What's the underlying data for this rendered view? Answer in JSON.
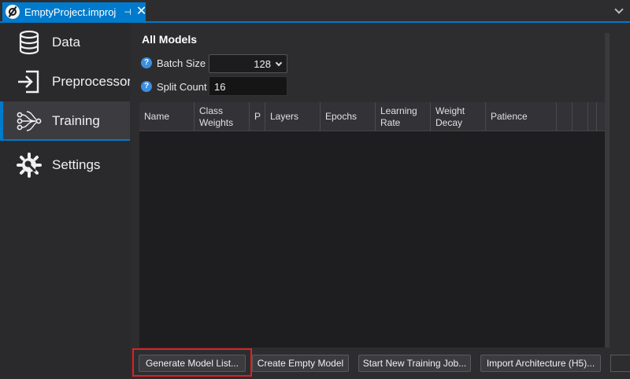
{
  "tab": {
    "title": "EmptyProject.improj",
    "pin": "⊣",
    "close": "✕"
  },
  "sidebar": {
    "items": [
      {
        "label": "Data",
        "icon": "database-icon",
        "active": false
      },
      {
        "label": "Preprocessor",
        "icon": "import-icon",
        "active": false
      },
      {
        "label": "Training",
        "icon": "neural-network-icon",
        "active": true
      },
      {
        "label": "Settings",
        "icon": "settings-icon",
        "active": false
      }
    ]
  },
  "main": {
    "title": "All Models",
    "batch_size": {
      "label": "Batch Size",
      "value": "128",
      "help": "?"
    },
    "split_count": {
      "label": "Split Count",
      "value": "16",
      "help": "?"
    },
    "table": {
      "columns": [
        "Name",
        "Class Weights",
        "P",
        "Layers",
        "Epochs",
        "Learning Rate",
        "Weight Decay",
        "Patience",
        "",
        "",
        "",
        ""
      ],
      "rows": []
    },
    "buttons": {
      "generate": "Generate Model List...",
      "create_empty": "Create Empty Model",
      "start_job": "Start New Training Job...",
      "import_arch": "Import Architecture (H5)..."
    }
  },
  "colors": {
    "accent": "#007acc",
    "highlight": "#e02020",
    "help": "#3c8ee0"
  }
}
